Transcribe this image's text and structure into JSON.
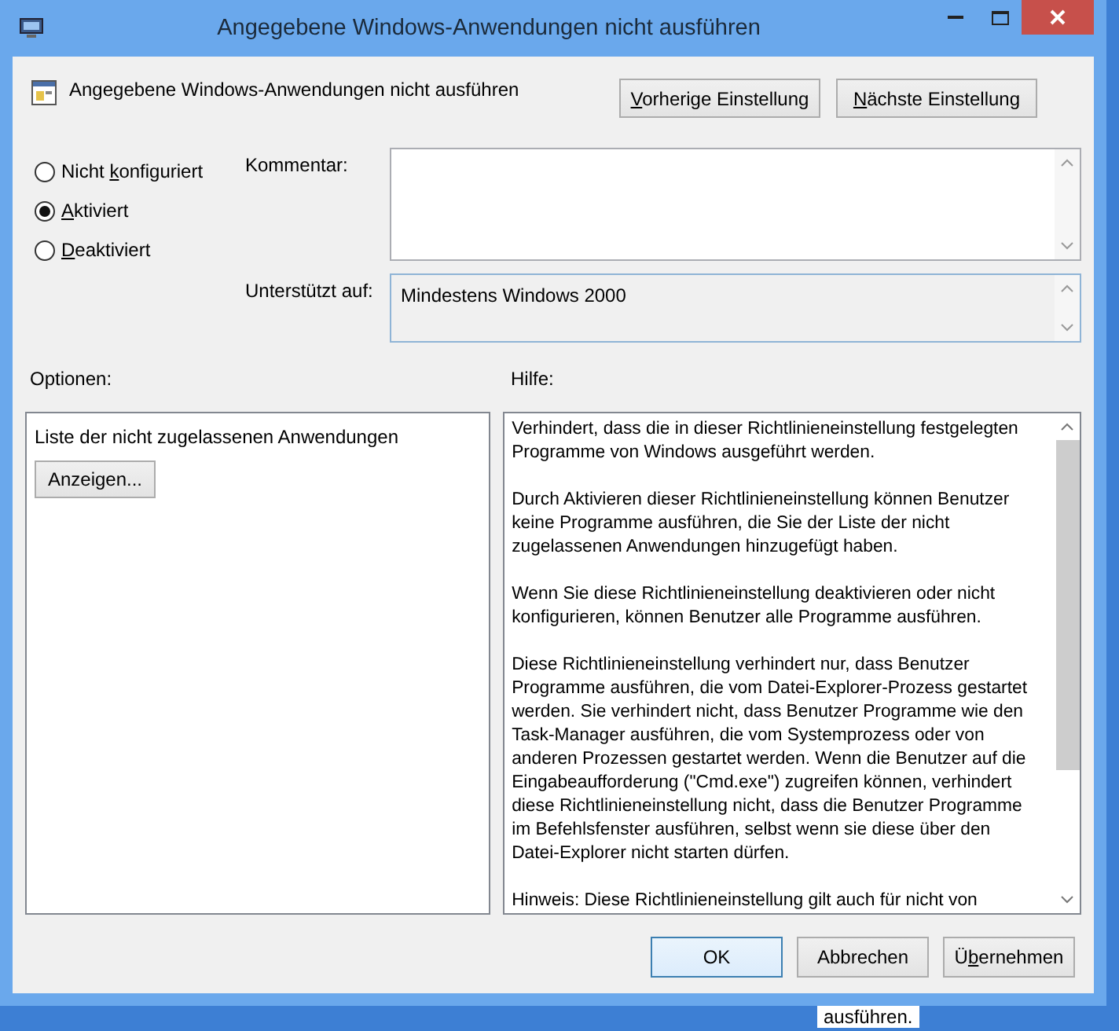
{
  "window": {
    "title": "Angegebene Windows-Anwendungen nicht ausführen"
  },
  "header": {
    "title": "Angegebene Windows-Anwendungen nicht ausführen",
    "buttons": [
      {
        "key": "V",
        "after": "orherige Einstellung"
      },
      {
        "key": "N",
        "after": "ächste Einstellung"
      }
    ]
  },
  "radios": [
    {
      "label": {
        "before": "Nicht ",
        "key": "k",
        "after": "onfiguriert"
      },
      "selected": false
    },
    {
      "label": {
        "key": "A",
        "after": "ktiviert"
      },
      "selected": true
    },
    {
      "label": {
        "key": "D",
        "after": "eaktiviert"
      },
      "selected": false
    }
  ],
  "comment": {
    "label": "Kommentar:"
  },
  "supported": {
    "label": "Unterstützt auf:",
    "value": "Mindestens Windows 2000"
  },
  "options": {
    "label": "Optionen:",
    "text": "Liste der nicht zugelassenen Anwendungen",
    "button": "Anzeigen..."
  },
  "help": {
    "label": "Hilfe:",
    "paragraphs": [
      [
        "Verhindert, dass die in dieser Richtlinieneinstellung festgelegten",
        "Programme von Windows ausgeführt werden."
      ],
      [
        "Durch Aktivieren dieser Richtlinieneinstellung können Benutzer",
        "keine Programme ausführen, die Sie der Liste der nicht",
        "zugelassenen Anwendungen hinzugefügt haben."
      ],
      [
        "Wenn Sie diese Richtlinieneinstellung deaktivieren oder nicht",
        "konfigurieren, können Benutzer alle Programme ausführen."
      ],
      [
        "Diese Richtlinieneinstellung verhindert nur, dass Benutzer",
        "Programme ausführen, die vom Datei-Explorer-Prozess gestartet",
        "werden. Sie verhindert nicht, dass Benutzer Programme wie den",
        "Task-Manager ausführen, die vom Systemprozess oder von",
        "anderen Prozessen gestartet werden.  Wenn die Benutzer auf die",
        "Eingabeaufforderung (\"Cmd.exe\") zugreifen können, verhindert",
        "diese Richtlinieneinstellung nicht, dass die Benutzer Programme",
        "im Befehlsfenster ausführen, selbst wenn sie diese über den",
        "Datei-Explorer nicht starten dürfen."
      ],
      [
        "Hinweis: Diese Richtlinieneinstellung gilt auch für nicht von"
      ]
    ]
  },
  "footer": {
    "buttons": [
      {
        "label": {
          "before": "OK"
        },
        "default": true
      },
      {
        "label": {
          "before": "Abbrechen"
        },
        "default": false
      },
      {
        "label": {
          "before": "Ü",
          "key": "b",
          "after": "ernehmen"
        },
        "default": false
      }
    ]
  },
  "background": {
    "text": "ausführen."
  }
}
